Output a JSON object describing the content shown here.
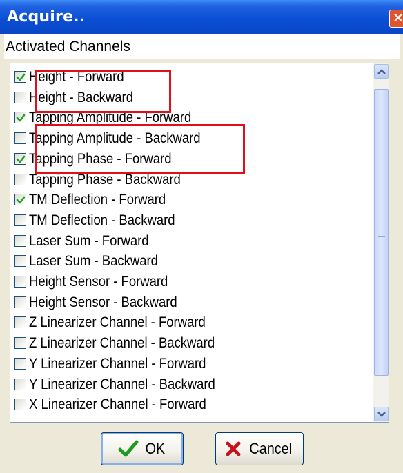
{
  "window": {
    "title": "Acquire..",
    "close_symbol": "✕"
  },
  "section": {
    "label": "Activated Channels"
  },
  "channels": [
    {
      "label": "Height  - Forward",
      "checked": true
    },
    {
      "label": "Height  - Backward",
      "checked": false
    },
    {
      "label": "Tapping Amplitude  - Forward",
      "checked": true
    },
    {
      "label": "Tapping Amplitude  - Backward",
      "checked": false
    },
    {
      "label": "Tapping Phase  - Forward",
      "checked": true
    },
    {
      "label": "Tapping Phase  - Backward",
      "checked": false
    },
    {
      "label": "TM Deflection  - Forward",
      "checked": true
    },
    {
      "label": "TM Deflection  - Backward",
      "checked": false
    },
    {
      "label": "Laser Sum  - Forward",
      "checked": false
    },
    {
      "label": "Laser Sum  - Backward",
      "checked": false
    },
    {
      "label": "Height Sensor  - Forward",
      "checked": false
    },
    {
      "label": "Height Sensor  - Backward",
      "checked": false
    },
    {
      "label": "Z Linearizer Channel  - Forward",
      "checked": false
    },
    {
      "label": "Z Linearizer Channel  - Backward",
      "checked": false
    },
    {
      "label": "Y Linearizer Channel  - Forward",
      "checked": false
    },
    {
      "label": "Y Linearizer Channel  - Backward",
      "checked": false
    },
    {
      "label": "X Linearizer Channel  - Forward",
      "checked": false
    }
  ],
  "buttons": {
    "ok": {
      "label": "OK",
      "icon": "checkmark-icon"
    },
    "cancel": {
      "label": "Cancel",
      "icon": "x-icon"
    }
  },
  "colors": {
    "titlebar": "#0A46C4",
    "highlight": "#E0101A",
    "check": "#21A121"
  }
}
